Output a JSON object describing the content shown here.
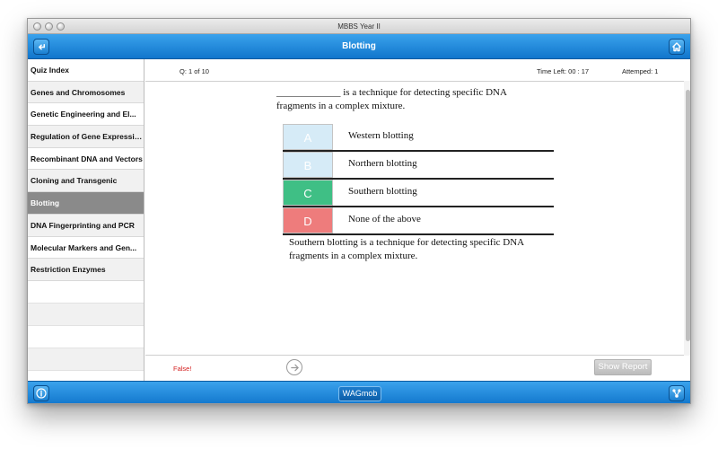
{
  "window": {
    "title": "MBBS Year  II"
  },
  "navbar": {
    "title": "Blotting"
  },
  "sidebar": {
    "items": [
      {
        "label": "Quiz Index"
      },
      {
        "label": "Genes and Chromosomes"
      },
      {
        "label": "Genetic Engineering and El..."
      },
      {
        "label": "Regulation of Gene Expression"
      },
      {
        "label": "Recombinant DNA and Vectors"
      },
      {
        "label": "Cloning and Transgenic"
      },
      {
        "label": "Blotting"
      },
      {
        "label": "DNA Fingerprinting and PCR"
      },
      {
        "label": "Molecular Markers and Gen..."
      },
      {
        "label": "Restriction Enzymes"
      }
    ],
    "active_index": 6
  },
  "status": {
    "question_counter": "Q: 1 of 10",
    "time_left": "Time Left: 00 : 17",
    "attempted": "Attemped: 1"
  },
  "question": {
    "text": "_____________ is a technique for detecting specific DNA fragments in a complex mixture.",
    "options": [
      {
        "letter": "A",
        "text": "Western blotting",
        "color": "#d6ebf7"
      },
      {
        "letter": "B",
        "text": "Northern blotting",
        "color": "#d6ebf7"
      },
      {
        "letter": "C",
        "text": "Southern blotting",
        "color": "#3fbf85"
      },
      {
        "letter": "D",
        "text": "None of the above",
        "color": "#ee7c7c"
      }
    ],
    "explanation": "Southern blotting is a technique for detecting specific DNA fragments in a complex mixture."
  },
  "result": {
    "label": "False!"
  },
  "actions": {
    "show_report": "Show Report"
  },
  "footer": {
    "logo": "WAGmob"
  },
  "colors": {
    "accent": "#1a86d8",
    "correct": "#3fbf85",
    "wrong": "#ee7c7c",
    "error_text": "#d42020"
  },
  "icons": {
    "back": "back-arrow-icon",
    "home": "home-icon",
    "next": "right-arrow-circle-icon",
    "info": "info-icon",
    "share": "share-icon"
  }
}
